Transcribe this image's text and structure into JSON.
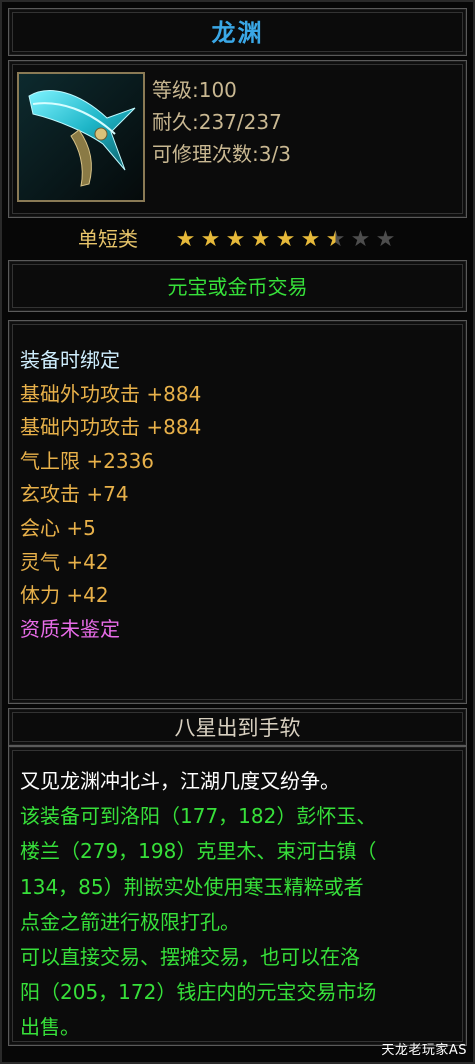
{
  "item": {
    "name": "龙渊",
    "name_color": "#3aa7e6",
    "icon": "blade-weapon-icon",
    "stats": [
      {
        "label": "等级:100",
        "color": "#c9b892"
      },
      {
        "label": "耐久:237/237",
        "color": "#c9b892"
      },
      {
        "label": "可修理次数:3/3",
        "color": "#c9b892"
      }
    ],
    "category": "单短类",
    "category_color": "#e7c46a",
    "stars": {
      "filled": 6,
      "half": 1,
      "total": 9,
      "filled_color": "#e6b93a",
      "empty_color": "#4d4d4d"
    },
    "trade_text": "元宝或金币交易",
    "trade_color": "#37e03a"
  },
  "attributes": [
    {
      "text": "装备时绑定",
      "color": "#cfeefe"
    },
    {
      "text": "基础外功攻击 +884",
      "color": "#e8b14a"
    },
    {
      "text": "基础内功攻击 +884",
      "color": "#e8b14a"
    },
    {
      "text": "气上限 +2336",
      "color": "#e8b14a"
    },
    {
      "text": "玄攻击 +74",
      "color": "#e8b14a"
    },
    {
      "text": "会心 +5",
      "color": "#e8b14a"
    },
    {
      "text": "灵气 +42",
      "color": "#e8b14a"
    },
    {
      "text": "体力 +42",
      "color": "#e8b14a"
    },
    {
      "text": "资质未鉴定",
      "color": "#e86ce8"
    }
  ],
  "section_header": {
    "text": "八星出到手软",
    "color": "#d8d0c0"
  },
  "description": [
    {
      "text": "又见龙渊冲北斗，江湖几度又纷争。",
      "color": "#ffffff"
    },
    {
      "text": "该装备可到洛阳（177，182）彭怀玉、",
      "color": "#37e03a"
    },
    {
      "text": "楼兰（279，198）克里木、束河古镇（",
      "color": "#37e03a"
    },
    {
      "text": "134，85）荆嵌实处使用寒玉精粹或者",
      "color": "#37e03a"
    },
    {
      "text": "点金之箭进行极限打孔。",
      "color": "#37e03a"
    },
    {
      "text": "可以直接交易、摆摊交易，也可以在洛",
      "color": "#37e03a"
    },
    {
      "text": "阳（205，172）钱庄内的元宝交易市场",
      "color": "#37e03a"
    },
    {
      "text": "出售。",
      "color": "#37e03a"
    }
  ],
  "watermark": "天龙老玩家AS"
}
